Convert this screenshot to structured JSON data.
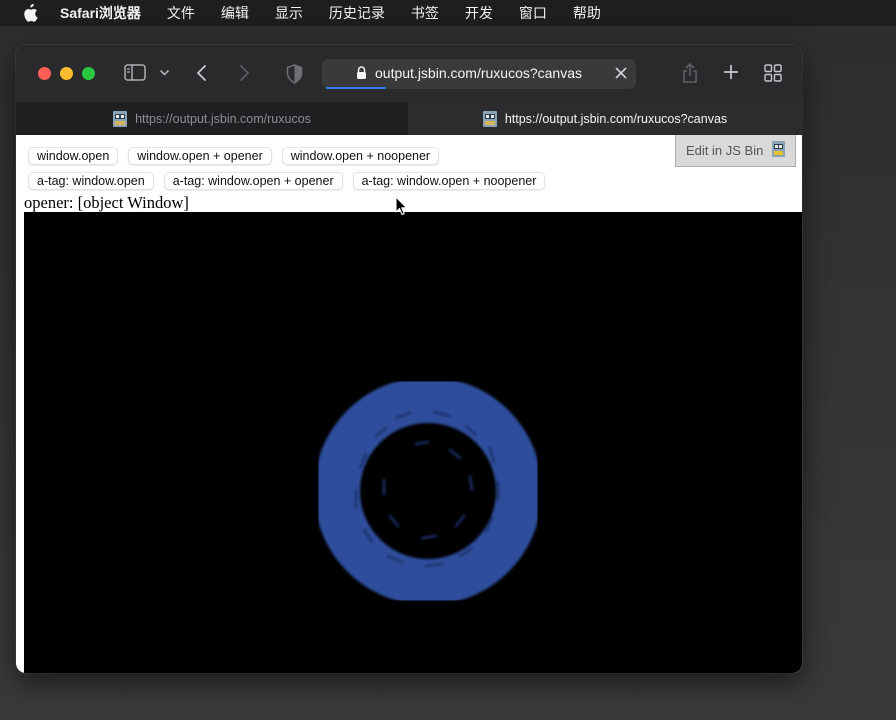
{
  "menubar": {
    "app_name": "Safari浏览器",
    "items": [
      "文件",
      "编辑",
      "显示",
      "历史记录",
      "书签",
      "开发",
      "窗口",
      "帮助"
    ]
  },
  "window": {
    "address_bar": {
      "url": "output.jsbin.com/ruxucos?canvas"
    },
    "tabs": [
      {
        "title": "https://output.jsbin.com/ruxucos",
        "active": false
      },
      {
        "title": "https://output.jsbin.com/ruxucos?canvas",
        "active": true
      }
    ]
  },
  "page": {
    "buttons_row1": [
      "window.open",
      "window.open + opener",
      "window.open + noopener"
    ],
    "buttons_row2": [
      "a-tag: window.open",
      "a-tag: window.open + opener",
      "a-tag: window.open + noopener"
    ],
    "edit_link": "Edit in JS Bin",
    "opener_text": "opener: [object Window]",
    "canvas": {
      "background": "#000000",
      "ring_color": "#2f4d9c"
    }
  }
}
